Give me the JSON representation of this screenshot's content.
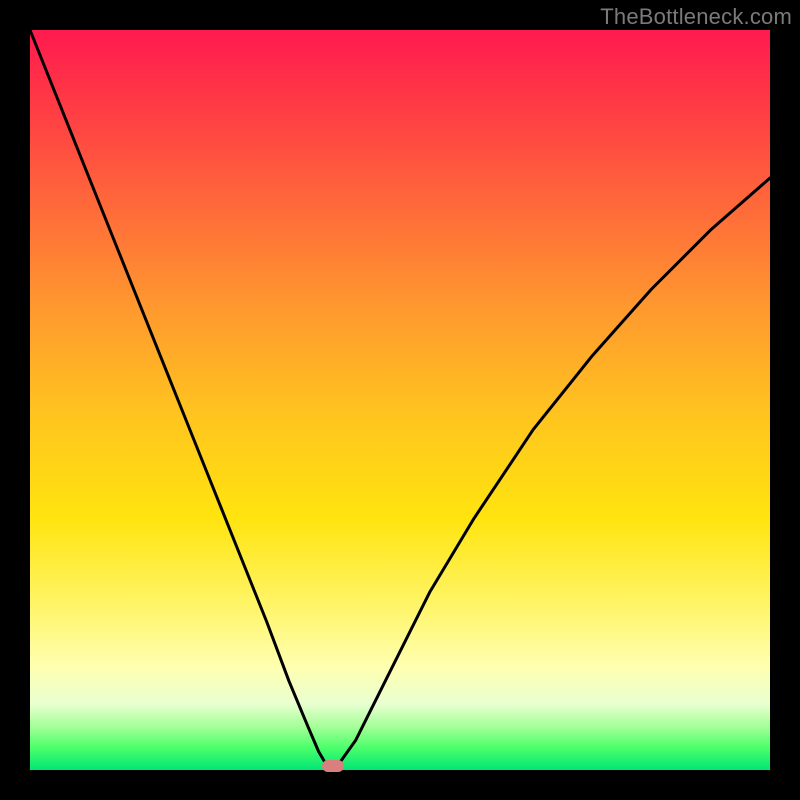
{
  "watermark": "TheBottleneck.com",
  "chart_data": {
    "type": "line",
    "title": "",
    "xlabel": "",
    "ylabel": "",
    "xlim": [
      0,
      100
    ],
    "ylim": [
      0,
      100
    ],
    "grid": false,
    "series": [
      {
        "name": "bottleneck-curve",
        "x_pct": [
          0,
          4,
          8,
          12,
          16,
          20,
          24,
          28,
          32,
          35,
          37.5,
          39,
          40,
          41,
          42,
          44,
          48,
          54,
          60,
          68,
          76,
          84,
          92,
          100
        ],
        "y_pct": [
          100,
          90,
          80,
          70,
          60,
          50,
          40,
          30,
          20,
          12,
          6,
          2.5,
          0.8,
          0.5,
          1.2,
          4,
          12,
          24,
          34,
          46,
          56,
          65,
          73,
          80
        ]
      }
    ],
    "optimum_marker": {
      "x_pct": 41,
      "y_pct": 0.5
    },
    "background_gradient": {
      "stops": [
        {
          "pos": 0,
          "color": "#ff1a4f"
        },
        {
          "pos": 10,
          "color": "#ff3a45"
        },
        {
          "pos": 24,
          "color": "#ff6a3a"
        },
        {
          "pos": 38,
          "color": "#ff9a2e"
        },
        {
          "pos": 52,
          "color": "#ffc41f"
        },
        {
          "pos": 66,
          "color": "#ffe40f"
        },
        {
          "pos": 78,
          "color": "#fff56a"
        },
        {
          "pos": 86,
          "color": "#ffffb0"
        },
        {
          "pos": 91,
          "color": "#eaffd0"
        },
        {
          "pos": 94,
          "color": "#a8ff9a"
        },
        {
          "pos": 97,
          "color": "#4bff6a"
        },
        {
          "pos": 100,
          "color": "#00e676"
        }
      ]
    }
  }
}
